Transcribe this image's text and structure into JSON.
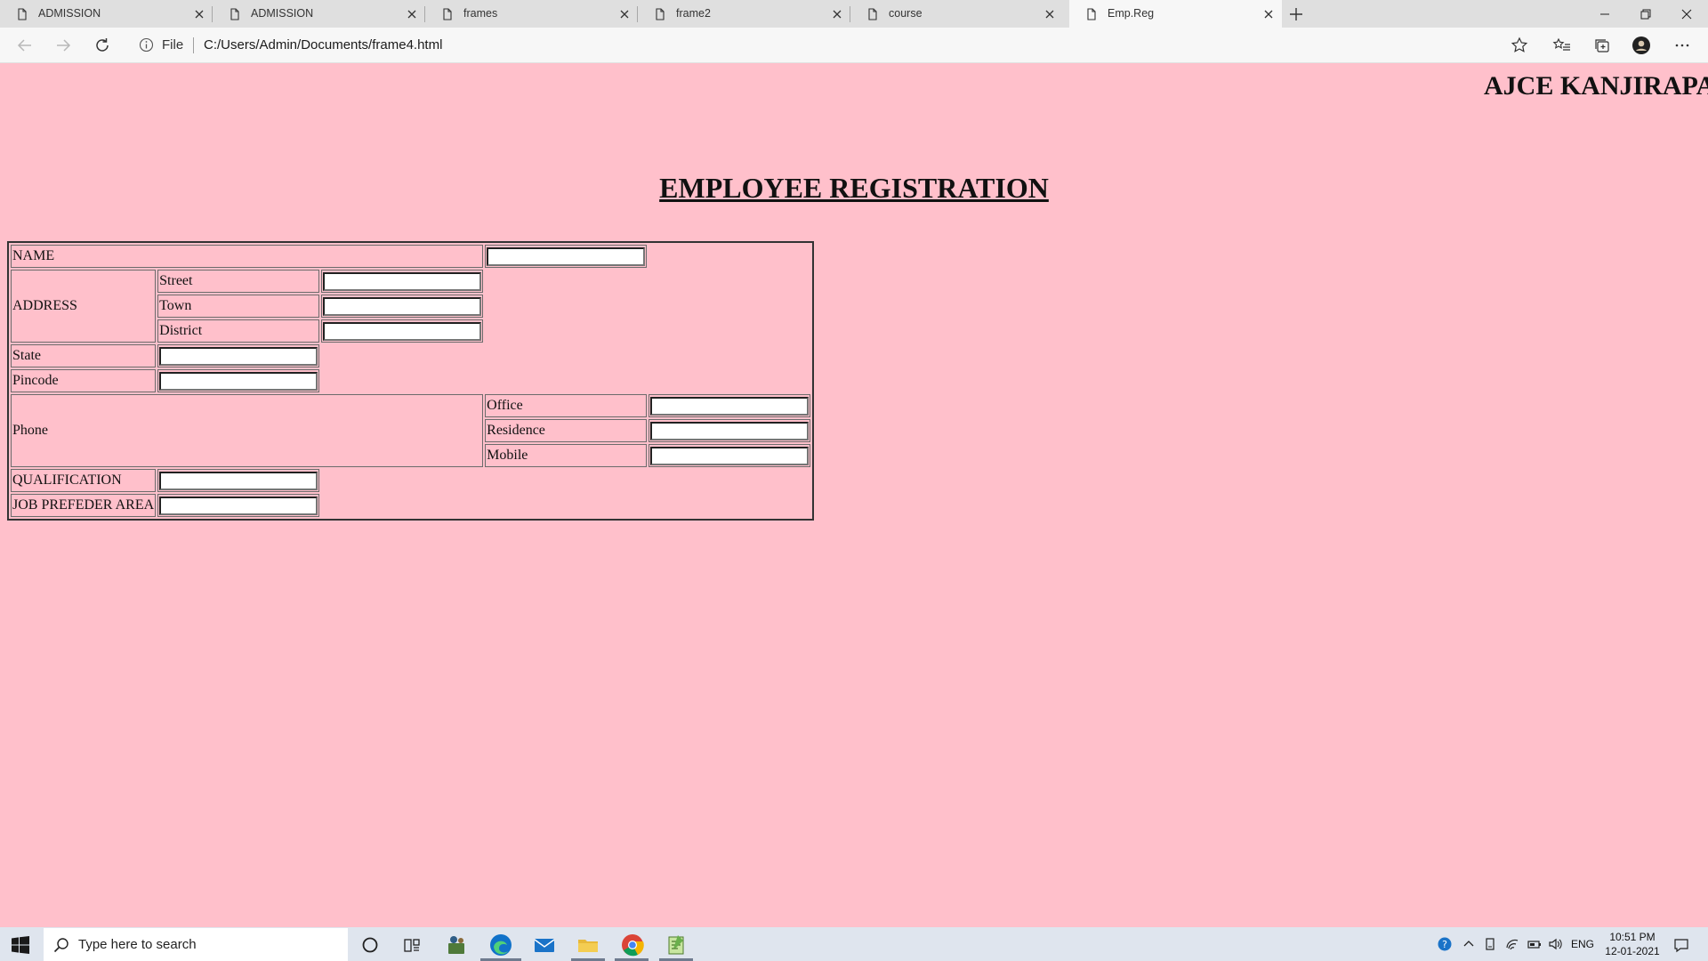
{
  "browser": {
    "tabs": [
      {
        "title": "ADMISSION",
        "active": false
      },
      {
        "title": "ADMISSION",
        "active": false
      },
      {
        "title": "frames",
        "active": false
      },
      {
        "title": "frame2",
        "active": false
      },
      {
        "title": "course",
        "active": false
      },
      {
        "title": "Emp.Reg",
        "active": true
      }
    ],
    "address": {
      "scheme_label": "File",
      "url": "C:/Users/Admin/Documents/frame4.html"
    }
  },
  "page": {
    "marquee_text": "AJCE KANJIRAPALLY",
    "heading": "EMPLOYEE REGISTRATION",
    "labels": {
      "name": "NAME",
      "address": "ADDRESS",
      "street": "Street",
      "town": "Town",
      "district": "District",
      "state": "State",
      "pincode": "Pincode",
      "phone": "Phone",
      "office": "Office",
      "residence": "Residence",
      "mobile": "Mobile",
      "qualification": "QUALIFICATION",
      "job_area": "JOB PREFEDER AREA"
    },
    "background_color": "#ffc0cb"
  },
  "taskbar": {
    "search_placeholder": "Type here to search",
    "language": "ENG",
    "time": "10:51 PM",
    "date": "12-01-2021"
  }
}
